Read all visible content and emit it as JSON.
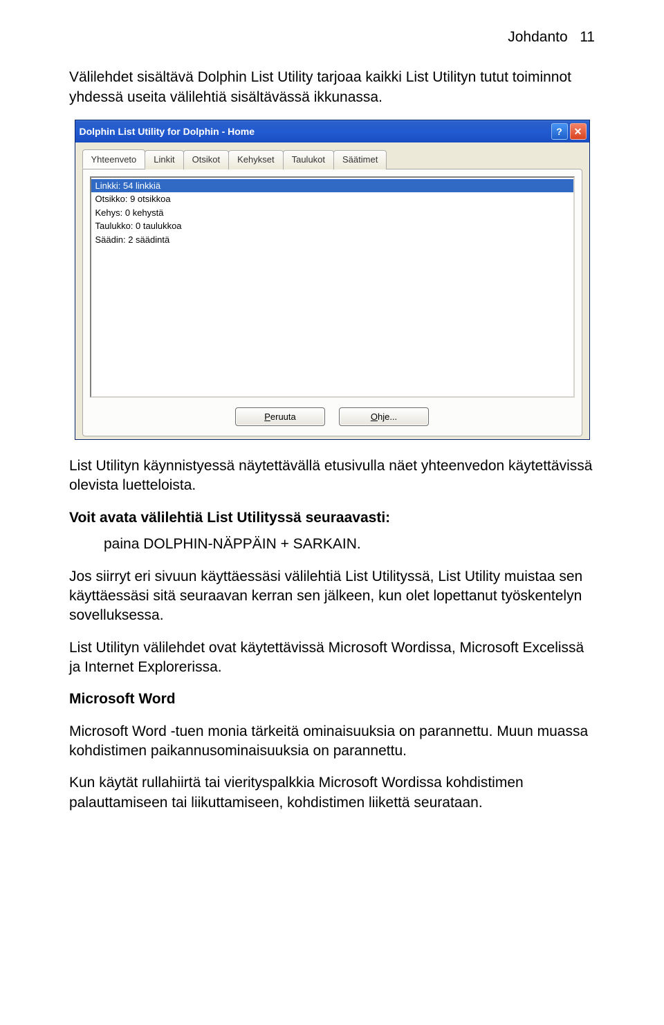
{
  "header": {
    "section": "Johdanto",
    "page": "11"
  },
  "intro_para": "Välilehdet sisältävä Dolphin List Utility tarjoaa kaikki List Utilityn tutut toiminnot yhdessä useita välilehtiä sisältävässä ikkunassa.",
  "window": {
    "title": "Dolphin List Utility for Dolphin - Home",
    "help_glyph": "?",
    "close_glyph": "✕",
    "tabs": [
      {
        "label": "Yhteenveto",
        "active": true
      },
      {
        "label": "Linkit"
      },
      {
        "label": "Otsikot"
      },
      {
        "label": "Kehykset"
      },
      {
        "label": "Taulukot"
      },
      {
        "label": "Säätimet"
      }
    ],
    "list_items": [
      "Linkki: 54 linkkiä",
      "Otsikko: 9 otsikkoa",
      "Kehys: 0 kehystä",
      "Taulukko: 0 taulukkoa",
      "Säädin: 2 säädintä"
    ],
    "buttons": {
      "cancel_pre": "P",
      "cancel_rest": "eruuta",
      "help_pre": "O",
      "help_rest": "hje..."
    }
  },
  "after1": "List Utilityn käynnistyessä näytettävällä etusivulla näet yhteenvedon käytettävissä olevista luetteloista.",
  "avata_heading": "Voit avata välilehtiä List Utilityssä seuraavasti:",
  "avata_step": "paina DOLPHIN-NÄPPÄIN + SARKAIN.",
  "jos_para": "Jos siirryt eri sivuun käyttäessäsi välilehtiä List Utilityssä, List Utility muistaa sen käyttäessäsi sitä seuraavan kerran sen jälkeen, kun olet lopettanut työskentelyn sovelluksessa.",
  "avail_para": "List Utilityn välilehdet ovat käytettävissä Microsoft Wordissa, Microsoft Excelissä ja Internet Explorerissa.",
  "msword_heading": "Microsoft Word",
  "msword_p1": "Microsoft Word -tuen monia tärkeitä ominaisuuksia on parannettu. Muun muassa kohdistimen paikannusominaisuuksia on parannettu.",
  "msword_p2": "Kun käytät rullahiirtä tai vierityspalkkia Microsoft Wordissa kohdistimen palauttamiseen tai liikuttamiseen, kohdistimen liikettä seurataan."
}
